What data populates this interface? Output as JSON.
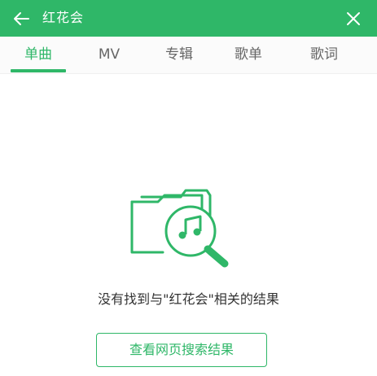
{
  "colors": {
    "accent": "#2fb768",
    "header_text": "#ffffff",
    "tab_inactive": "#666666"
  },
  "header": {
    "title": "红花会",
    "back_icon": "arrow-left-icon",
    "close_icon": "close-icon"
  },
  "tabs": [
    {
      "label": "单曲",
      "active": true
    },
    {
      "label": "MV",
      "active": false
    },
    {
      "label": "专辑",
      "active": false
    },
    {
      "label": "歌单",
      "active": false
    },
    {
      "label": "歌词",
      "active": false
    }
  ],
  "empty_state": {
    "icon": "folder-music-search-icon",
    "message": "没有找到与\"红花会\"相关的结果",
    "button_label": "查看网页搜索结果"
  }
}
